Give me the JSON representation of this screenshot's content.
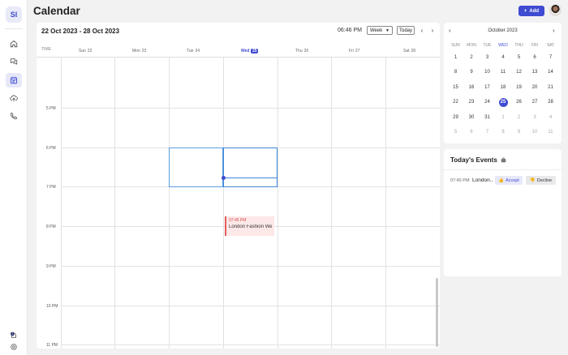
{
  "app": {
    "logo_text": "SI"
  },
  "sidebar": {
    "items": [
      {
        "name": "home",
        "icon": "home-icon",
        "active": false
      },
      {
        "name": "messages",
        "icon": "chat-icon",
        "active": false
      },
      {
        "name": "calendar",
        "icon": "calendar-icon",
        "active": true
      },
      {
        "name": "cloud",
        "icon": "cloud-upload-icon",
        "active": false
      },
      {
        "name": "calls",
        "icon": "phone-icon",
        "active": false
      }
    ],
    "notification_count": "2"
  },
  "header": {
    "title": "Calendar",
    "add_label": "Add"
  },
  "toolbar": {
    "range": "22 Oct 2023 - 28 Oct 2023",
    "current_time": "06:46 PM",
    "view": "Week",
    "today_label": "Today"
  },
  "week": {
    "time_header": "TIME",
    "days": [
      {
        "name": "Sun",
        "num": "22",
        "today": false
      },
      {
        "name": "Mon",
        "num": "23",
        "today": false
      },
      {
        "name": "Tue",
        "num": "24",
        "today": false
      },
      {
        "name": "Wed",
        "num": "25",
        "today": true
      },
      {
        "name": "Thu",
        "num": "26",
        "today": false
      },
      {
        "name": "Fri",
        "num": "27",
        "today": false
      },
      {
        "name": "Sat",
        "num": "28",
        "today": false
      }
    ],
    "hours": [
      "5 PM",
      "6 PM",
      "7 PM",
      "8 PM",
      "9 PM",
      "10 PM",
      "11 PM"
    ],
    "event": {
      "time": "07:45 PM",
      "title": "London Fashion We..."
    }
  },
  "mini_calendar": {
    "title": "October 2023",
    "dow": [
      "SUN",
      "MON",
      "TUE",
      "WED",
      "THU",
      "FRI",
      "SAT"
    ],
    "weeks": [
      [
        "1",
        "2",
        "3",
        "4",
        "5",
        "6",
        "7"
      ],
      [
        "8",
        "9",
        "10",
        "11",
        "12",
        "13",
        "14"
      ],
      [
        "15",
        "16",
        "17",
        "18",
        "19",
        "20",
        "21"
      ],
      [
        "22",
        "23",
        "24",
        "25",
        "26",
        "27",
        "28"
      ],
      [
        "29",
        "30",
        "31",
        "1",
        "2",
        "3",
        "4"
      ],
      [
        "5",
        "6",
        "7",
        "8",
        "9",
        "10",
        "11"
      ]
    ]
  },
  "todays_events": {
    "title": "Today's Events",
    "items": [
      {
        "time": "07:45 PM",
        "name": "London...",
        "accept": "Accept",
        "decline": "Decline"
      }
    ]
  },
  "colors": {
    "accent": "#3f4bd1",
    "event_bg": "#fde7e7",
    "event_border": "#e15c5c"
  }
}
